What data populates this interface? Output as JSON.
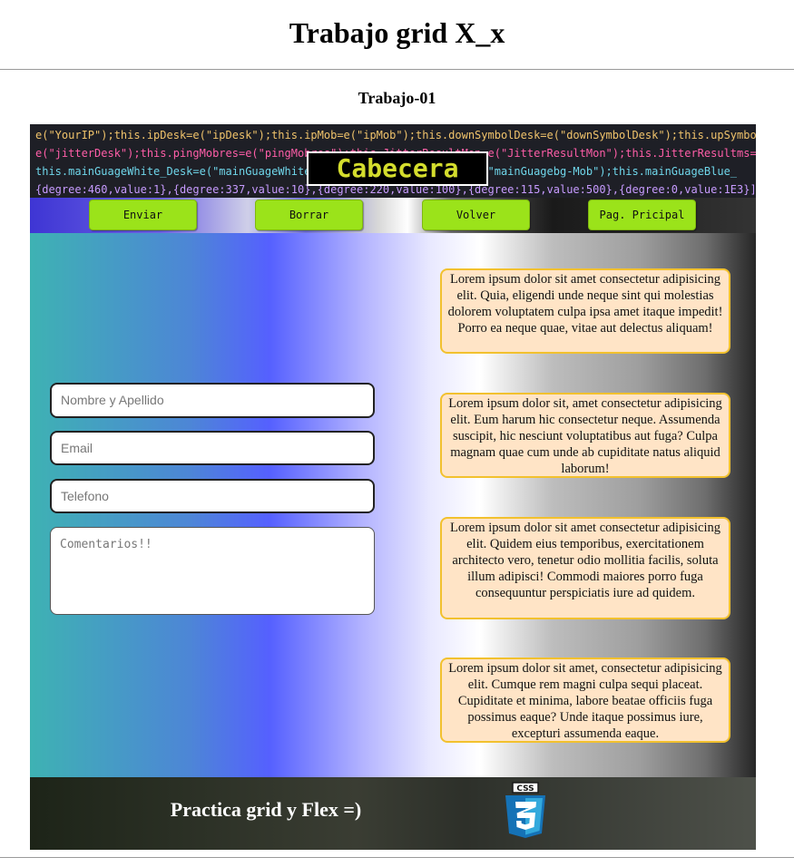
{
  "page": {
    "title": "Trabajo grid X_x",
    "subtitle": "Trabajo-01"
  },
  "header": {
    "banner": "Cabecera",
    "code_lines": [
      "e(\"YourIP\");this.ipDesk=e(\"ipDesk\");this.ipMob=e(\"ipMob\");this.downSymbolDesk=e(\"downSymbolDesk\");this.upSymbol",
      "e(\"jitterDesk\");this.pingMobres=e(\"pingMobres\");this.JitterResultMon=e(\"JitterResultMon\");this.JitterResultms=e",
      "this.mainGuageWhite_Desk=e(\"mainGuageWhite_Desk\");this.mainGuagebg=e(\"mainGuagebg-Mob\");this.mainGuageBlue_",
      "{degree:460,value:1},{degree:337,value:10},{degree:220,value:100},{degree:115,value:500},{degree:0,value:1E3}]"
    ]
  },
  "nav": {
    "buttons": [
      "Enviar",
      "Borrar",
      "Volver",
      "Pag. Pricipal"
    ],
    "button_color": "#9be31a"
  },
  "form": {
    "name_placeholder": "Nombre y Apellido",
    "email_placeholder": "Email",
    "phone_placeholder": "Telefono",
    "comments_placeholder": "Comentarios!!"
  },
  "cards": [
    "Lorem ipsum dolor sit amet consectetur adipisicing elit. Quia, eligendi unde neque sint qui molestias dolorem voluptatem culpa ipsa amet itaque impedit! Porro ea neque quae, vitae aut delectus aliquam!",
    "Lorem ipsum dolor sit, amet consectetur adipisicing elit. Eum harum hic consectetur neque. Assumenda suscipit, hic nesciunt voluptatibus aut fuga? Culpa magnam quae cum unde ab cupiditate natus aliquid laborum!",
    "Lorem ipsum dolor sit amet consectetur adipisicing elit. Quidem eius temporibus, exercitationem architecto vero, tenetur odio mollitia facilis, soluta illum adipisci! Commodi maiores porro fuga consequuntur perspiciatis iure ad quidem.",
    "Lorem ipsum dolor sit amet, consectetur adipisicing elit. Cumque rem magni culpa sequi placeat. Cupiditate et minima, labore beatae officiis fuga possimus eaque? Unde itaque possimus iure, excepturi assumenda eaque."
  ],
  "footer": {
    "text": "Practica grid y Flex =)",
    "logo": "css3-icon",
    "logo_text": "CSS",
    "logo_color": "#1572b6"
  }
}
